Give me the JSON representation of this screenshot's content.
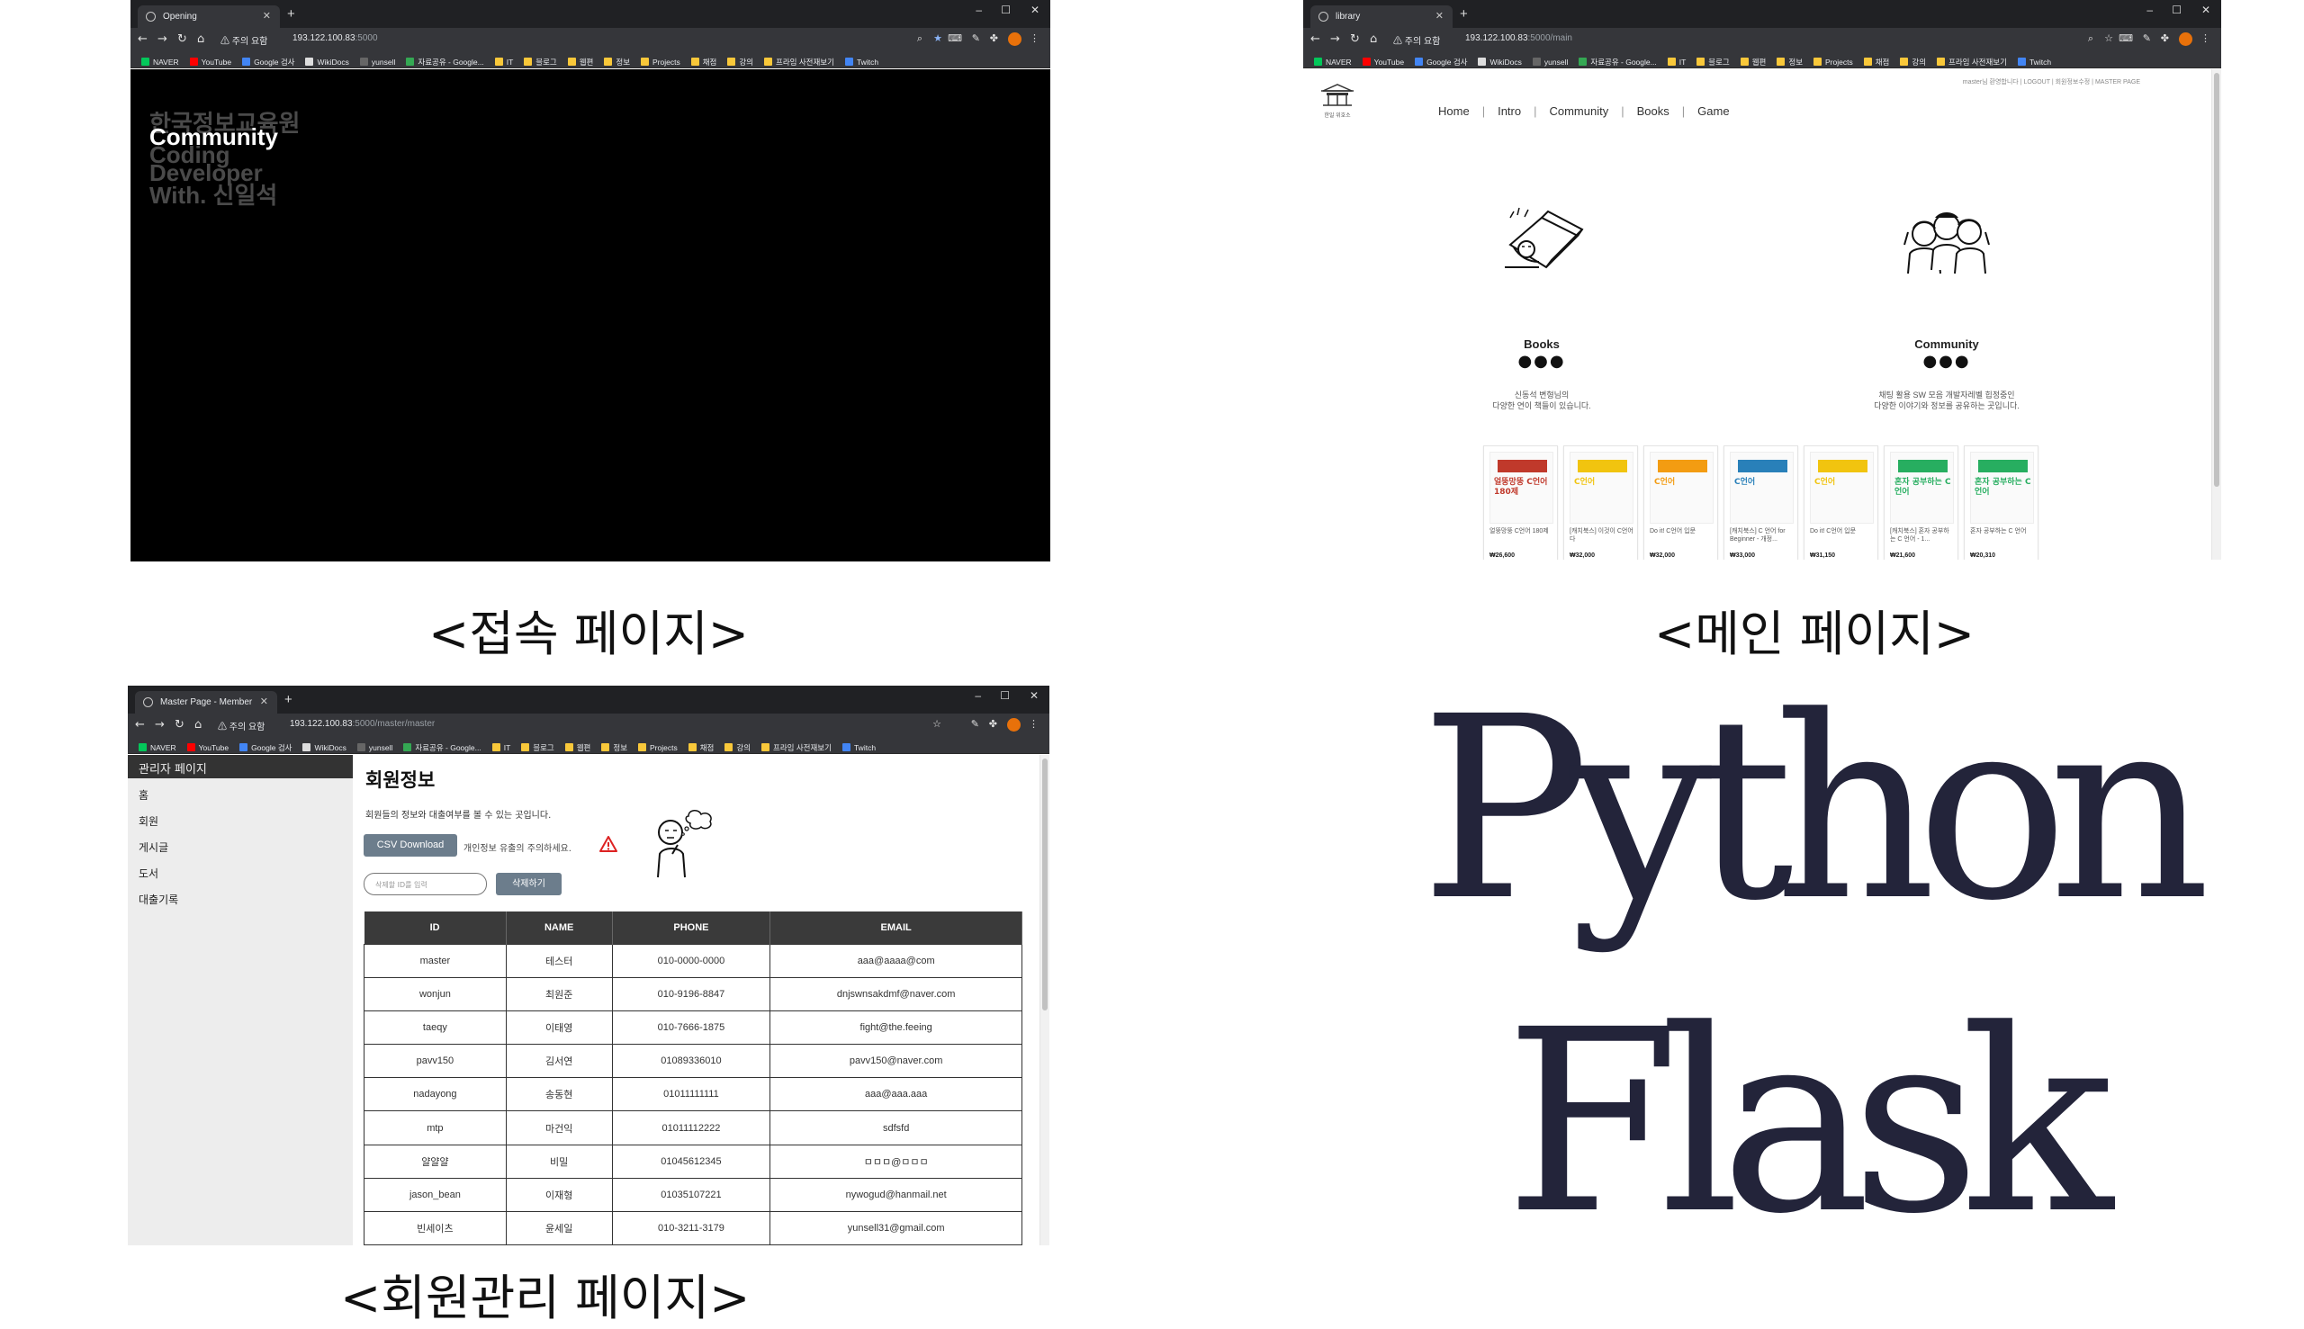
{
  "captions": {
    "opening": "<접속 페이지>",
    "main": "<메인 페이지>",
    "admin": "<회원관리 페이지>"
  },
  "logo": {
    "line1": "Python",
    "line2": "Flask",
    "color": "#23243a"
  },
  "browser": {
    "security_warning": "주의 요함",
    "host": "193.122.100.83",
    "bookmarks": [
      "NAVER",
      "YouTube",
      "Google 검사",
      "WikiDocs",
      "yunsell",
      "자료공유 - Google...",
      "IT",
      "블로그",
      "웹편",
      "정보",
      "Projects",
      "채점",
      "강의",
      "프라임 사전재보기",
      "Twitch"
    ]
  },
  "opening": {
    "tab_title": "Opening",
    "url_port": ":5000",
    "lines": [
      "한국정보교육원",
      "Community",
      "Coding",
      "Developer",
      "With. 신일석"
    ],
    "highlight_index": 1
  },
  "main": {
    "tab_title": "library",
    "url_path": ":5000/main",
    "logo_caption": "한일 위호소",
    "nav": [
      "Home",
      "Intro",
      "Community",
      "Books",
      "Game"
    ],
    "top_links": "master님 환영합니다 | LOGOUT | 회원정보수정 | MASTER PAGE",
    "features": [
      {
        "title": "Books",
        "dots": "●●●",
        "desc1": "신동석 변형님의",
        "desc2": "다양한 연이 책들이 있습니다."
      },
      {
        "title": "Community",
        "dots": "●●●",
        "desc1": "채팅 활용 SW 모음 개발자레벨 힙정중인",
        "desc2": "다양한 이야기와 정보를 공유하는 곳입니다."
      }
    ],
    "books": [
      {
        "name": "얼뚱망뚱 C언어 180제",
        "price": "₩26,600",
        "cover_text": "얼뚱망뚱 C언어 180제",
        "cover_color": "#c0392b"
      },
      {
        "name": "[캐치북스] 이것이 C언어 다",
        "price": "₩32,000",
        "cover_text": "C언어",
        "cover_color": "#f1c40f"
      },
      {
        "name": "Do it! C언어 입문",
        "price": "₩32,000",
        "cover_text": "C언어",
        "cover_color": "#f39c12"
      },
      {
        "name": "[캐치북스] C 언어 for Beginner - 개정...",
        "price": "₩33,000",
        "cover_text": "C언어",
        "cover_color": "#2980b9"
      },
      {
        "name": "Do it! C언어 입문",
        "price": "₩31,150",
        "cover_text": "C언어",
        "cover_color": "#f1c40f"
      },
      {
        "name": "[캐치북스] 혼자 공부하는 C 언어 - 1...",
        "price": "₩21,600",
        "cover_text": "혼자 공부하는 C언어",
        "cover_color": "#27ae60"
      },
      {
        "name": "혼자 공부하는 C 언어",
        "price": "₩20,310",
        "cover_text": "혼자 공부하는 C언어",
        "cover_color": "#27ae60"
      }
    ]
  },
  "admin": {
    "tab_title": "Master Page - Member",
    "url_path": ":5000/master/master",
    "side_header": "관리자 페이지",
    "menu": [
      "홈",
      "회원",
      "게시글",
      "도서",
      "대출기록"
    ],
    "title": "회원정보",
    "desc": "회원들의 정보와 대출여부를 볼 수 있는 곳입니다.",
    "csv_button": "CSV Download",
    "csv_note": "개인정보 유출의 주의하세요.",
    "delete_placeholder": "삭제할 ID를 입력",
    "delete_button": "삭제하기",
    "columns": [
      "ID",
      "NAME",
      "PHONE",
      "EMAIL"
    ],
    "rows": [
      [
        "master",
        "테스터",
        "010-0000-0000",
        "aaa@aaaa@com"
      ],
      [
        "wonjun",
        "최원준",
        "010-9196-8847",
        "dnjswnsakdmf@naver.com"
      ],
      [
        "taeqy",
        "이태영",
        "010-7666-1875",
        "fight@the.feeing"
      ],
      [
        "pavv150",
        "김서연",
        "01089336010",
        "pavv150@naver.com"
      ],
      [
        "nadayong",
        "송동현",
        "01011111111",
        "aaa@aaa.aaa"
      ],
      [
        "mtp",
        "마건익",
        "01011112222",
        "sdfsfd"
      ],
      [
        "얄얄얄",
        "비밀",
        "01045612345",
        "ㅁㅁㅁ@ㅁㅁㅁ"
      ],
      [
        "jason_bean",
        "이재형",
        "01035107221",
        "nywogud@hanmail.net"
      ],
      [
        "빈세이츠",
        "윤세일",
        "010-3211-3179",
        "yunsell31@gmail.com"
      ]
    ]
  }
}
